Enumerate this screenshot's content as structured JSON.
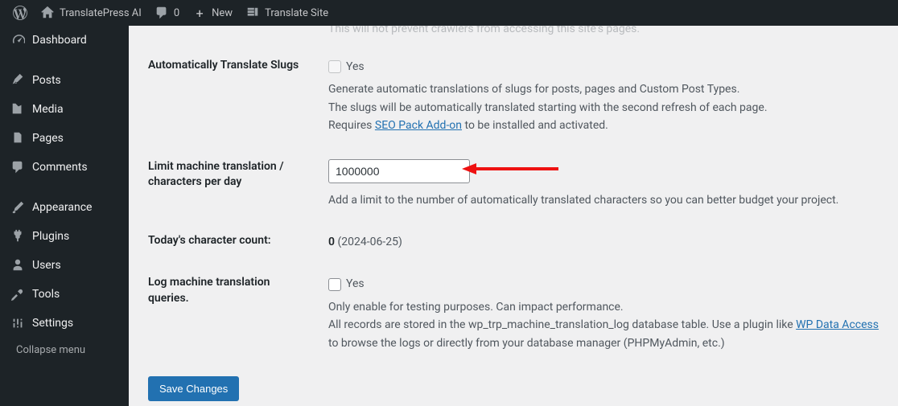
{
  "adminbar": {
    "site_name": "TranslatePress AI",
    "comments": "0",
    "new_label": "New",
    "translate_label": "Translate Site"
  },
  "sidebar": {
    "items": [
      {
        "label": "Dashboard"
      },
      {
        "label": "Posts"
      },
      {
        "label": "Media"
      },
      {
        "label": "Pages"
      },
      {
        "label": "Comments"
      },
      {
        "label": "Appearance"
      },
      {
        "label": "Plugins"
      },
      {
        "label": "Users"
      },
      {
        "label": "Tools"
      },
      {
        "label": "Settings"
      }
    ],
    "collapse": "Collapse menu"
  },
  "cutoff": {
    "text": "This will not prevent crawlers from accessing this site's pages."
  },
  "slugs": {
    "label": "Automatically Translate Slugs",
    "checkbox_label": "Yes",
    "desc_line1": "Generate automatic translations of slugs for posts, pages and Custom Post Types.",
    "desc_line2": "The slugs will be automatically translated starting with the second refresh of each page.",
    "desc_requires_prefix": "Requires ",
    "desc_requires_link": "SEO Pack Add-on",
    "desc_requires_suffix": " to be installed and activated."
  },
  "limit": {
    "label": "Limit machine translation / characters per day",
    "value": "1000000",
    "desc": "Add a limit to the number of automatically translated characters so you can better budget your project."
  },
  "count": {
    "label": "Today's character count:",
    "value": "0",
    "date": "(2024-06-25)"
  },
  "log": {
    "label": "Log machine translation queries.",
    "checkbox_label": "Yes",
    "desc_line1": "Only enable for testing purposes. Can impact performance.",
    "desc_prefix": "All records are stored in the wp_trp_machine_translation_log database table. Use a plugin like ",
    "desc_link": "WP Data Access",
    "desc_suffix": " to browse the logs or directly from your database manager (PHPMyAdmin, etc.)"
  },
  "save_button": "Save Changes"
}
